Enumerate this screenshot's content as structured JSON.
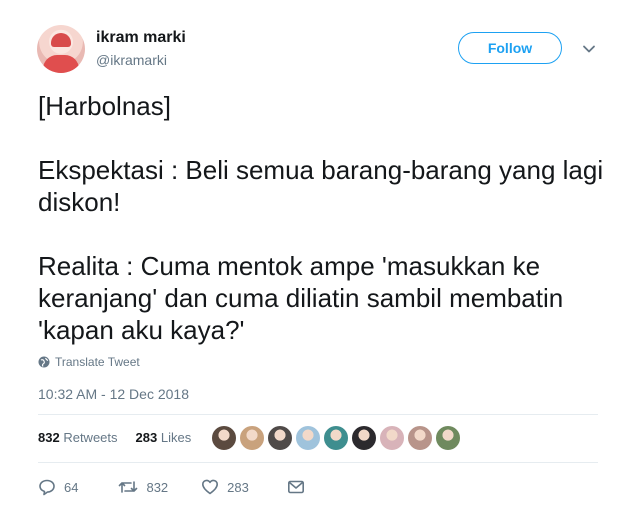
{
  "user": {
    "display_name": "ikram marki",
    "handle": "@ikramarki"
  },
  "follow_button": {
    "label": "Follow"
  },
  "tweet": {
    "paragraphs": [
      "[Harbolnas]",
      "Ekspektasi : Beli semua barang-barang yang lagi diskon!",
      "Realita : Cuma mentok ampe 'masukkan ke keranjang' dan cuma diliatin sambil membatin 'kapan aku kaya?'"
    ],
    "translate_label": "Translate Tweet",
    "timestamp": "10:32 AM - 12 Dec 2018"
  },
  "stats": {
    "retweets_count": "832",
    "retweets_label": "Retweets",
    "likes_count": "283",
    "likes_label": "Likes"
  },
  "liker_avatar_colors": [
    "#5b4a3f",
    "#c9a27d",
    "#4f4a48",
    "#9fc3dc",
    "#3e8e8f",
    "#2c2a2e",
    "#d8b3b9",
    "#b8948a",
    "#6f8a5e"
  ],
  "actions": {
    "reply_count": "64",
    "retweet_count": "832",
    "like_count": "283"
  },
  "colors": {
    "accent": "#1da1f2",
    "secondary_text": "#657786",
    "primary_text": "#14171a"
  }
}
